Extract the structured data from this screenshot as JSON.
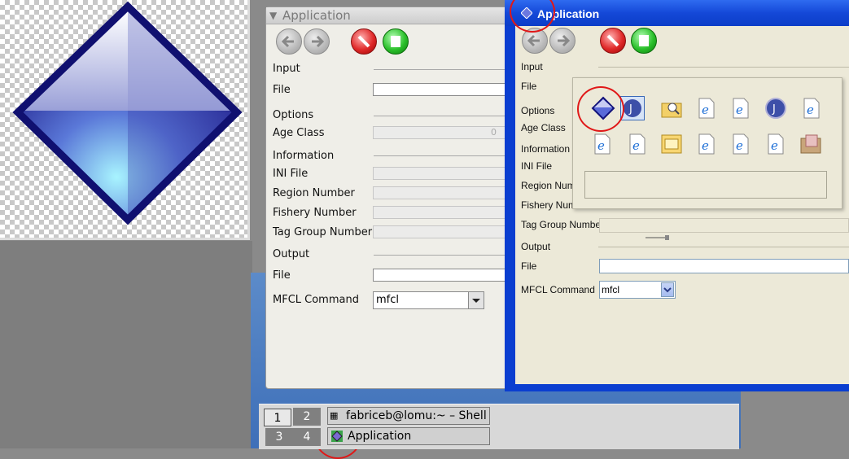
{
  "app_title": "Application",
  "form": {
    "input_section": "Input",
    "file_label": "File",
    "options_section": "Options",
    "age_class_label": "Age Class",
    "age_class_value": "0",
    "information_section": "Information",
    "ini_file_label": "INI File",
    "region_number_label": "Region Number",
    "fishery_number_label": "Fishery Number",
    "tag_group_number_label": "Tag Group Number",
    "output_section": "Output",
    "output_file_label": "File",
    "mfcl_command_label": "MFCL Command",
    "mfcl_command_value": "mfcl"
  },
  "xp_form": {
    "region_number_partial": "Region Numb",
    "fishery_number_partial": "Fishery Numb"
  },
  "taskbar": {
    "desktops": [
      "1",
      "2",
      "3",
      "4"
    ],
    "shell_task": "fabriceb@lomu:~ – Shell – K",
    "app_task": "Application"
  },
  "icons": {
    "row1": [
      "diamond-icon",
      "java-cup-icon",
      "folder-search-icon",
      "ie-document-icon",
      "ie-document-icon",
      "java-cup-icon",
      "ie-document-icon"
    ],
    "row2": [
      "ie-document-icon",
      "ie-document-icon",
      "dialog-icon",
      "ie-document-icon",
      "ie-document-icon",
      "ie-document-icon",
      "image-folder-icon"
    ]
  },
  "colors": {
    "xp_title": "#1448d8",
    "highlight_ring": "#e01818"
  }
}
